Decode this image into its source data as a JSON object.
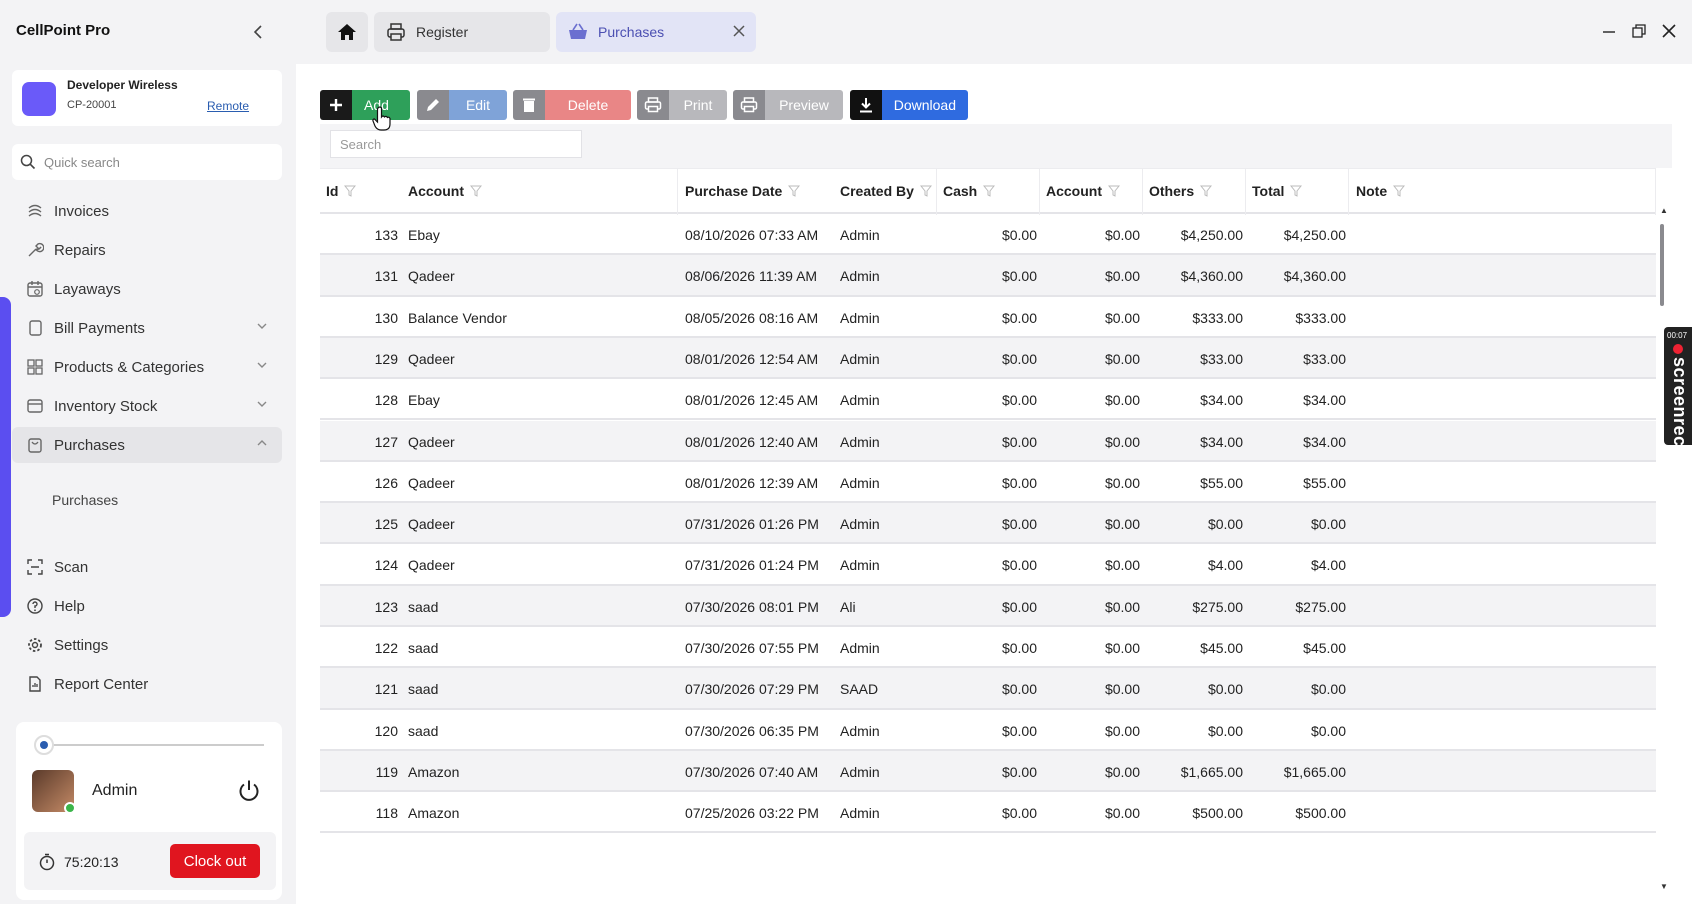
{
  "app": {
    "title": "CellPoint Pro"
  },
  "store": {
    "name": "Developer Wireless",
    "code": "CP-20001",
    "link": "Remote"
  },
  "search": {
    "placeholder": "Quick search"
  },
  "nav": {
    "items": [
      {
        "label": "Invoices",
        "icon": "invoice-icon"
      },
      {
        "label": "Repairs",
        "icon": "wrench-icon"
      },
      {
        "label": "Layaways",
        "icon": "calendar-icon"
      },
      {
        "label": "Bill Payments",
        "icon": "bill-icon",
        "expandable": true
      },
      {
        "label": "Products & Categories",
        "icon": "grid-icon",
        "expandable": true
      },
      {
        "label": "Inventory Stock",
        "icon": "box-icon",
        "expandable": true
      },
      {
        "label": "Purchases",
        "icon": "basket-icon",
        "expanded": true
      }
    ],
    "sub_items": [
      "Purchases"
    ],
    "bottom_items": [
      {
        "label": "Scan",
        "icon": "scan-icon"
      },
      {
        "label": "Help",
        "icon": "help-icon"
      },
      {
        "label": "Settings",
        "icon": "gear-icon"
      },
      {
        "label": "Report Center",
        "icon": "report-icon"
      }
    ]
  },
  "user": {
    "name": "Admin",
    "timer": "75:20:13",
    "clock_out": "Clock out",
    "status_color": "#3bb54a"
  },
  "tabs": [
    {
      "label": "Register",
      "icon": "printer-icon"
    },
    {
      "label": "Purchases",
      "icon": "basket-icon",
      "active": true
    }
  ],
  "toolbar": {
    "add": "Add",
    "edit": "Edit",
    "delete": "Delete",
    "print": "Print",
    "preview": "Preview",
    "download": "Download"
  },
  "grid": {
    "search_placeholder": "Search",
    "columns": [
      "Id",
      "Account",
      "Purchase Date",
      "Created By",
      "Cash",
      "Account",
      "Others",
      "Total",
      "Note"
    ],
    "rows": [
      {
        "id": "133",
        "account": "Ebay",
        "date": "08/10/2026 07:33 AM",
        "created_by": "Admin",
        "cash": "$0.00",
        "acct": "$0.00",
        "others": "$4,250.00",
        "total": "$4,250.00",
        "note": ""
      },
      {
        "id": "131",
        "account": "Qadeer",
        "date": "08/06/2026 11:39 AM",
        "created_by": "Admin",
        "cash": "$0.00",
        "acct": "$0.00",
        "others": "$4,360.00",
        "total": "$4,360.00",
        "note": ""
      },
      {
        "id": "130",
        "account": "Balance Vendor",
        "date": "08/05/2026 08:16 AM",
        "created_by": "Admin",
        "cash": "$0.00",
        "acct": "$0.00",
        "others": "$333.00",
        "total": "$333.00",
        "note": ""
      },
      {
        "id": "129",
        "account": "Qadeer",
        "date": "08/01/2026 12:54 AM",
        "created_by": "Admin",
        "cash": "$0.00",
        "acct": "$0.00",
        "others": "$33.00",
        "total": "$33.00",
        "note": ""
      },
      {
        "id": "128",
        "account": "Ebay",
        "date": "08/01/2026 12:45 AM",
        "created_by": "Admin",
        "cash": "$0.00",
        "acct": "$0.00",
        "others": "$34.00",
        "total": "$34.00",
        "note": ""
      },
      {
        "id": "127",
        "account": "Qadeer",
        "date": "08/01/2026 12:40 AM",
        "created_by": "Admin",
        "cash": "$0.00",
        "acct": "$0.00",
        "others": "$34.00",
        "total": "$34.00",
        "note": ""
      },
      {
        "id": "126",
        "account": "Qadeer",
        "date": "08/01/2026 12:39 AM",
        "created_by": "Admin",
        "cash": "$0.00",
        "acct": "$0.00",
        "others": "$55.00",
        "total": "$55.00",
        "note": ""
      },
      {
        "id": "125",
        "account": "Qadeer",
        "date": "07/31/2026 01:26 PM",
        "created_by": "Admin",
        "cash": "$0.00",
        "acct": "$0.00",
        "others": "$0.00",
        "total": "$0.00",
        "note": ""
      },
      {
        "id": "124",
        "account": "Qadeer",
        "date": "07/31/2026 01:24 PM",
        "created_by": "Admin",
        "cash": "$0.00",
        "acct": "$0.00",
        "others": "$4.00",
        "total": "$4.00",
        "note": ""
      },
      {
        "id": "123",
        "account": "saad",
        "date": "07/30/2026 08:01 PM",
        "created_by": "Ali",
        "cash": "$0.00",
        "acct": "$0.00",
        "others": "$275.00",
        "total": "$275.00",
        "note": ""
      },
      {
        "id": "122",
        "account": "saad",
        "date": "07/30/2026 07:55 PM",
        "created_by": "Admin",
        "cash": "$0.00",
        "acct": "$0.00",
        "others": "$45.00",
        "total": "$45.00",
        "note": ""
      },
      {
        "id": "121",
        "account": "saad",
        "date": "07/30/2026 07:29 PM",
        "created_by": "SAAD",
        "cash": "$0.00",
        "acct": "$0.00",
        "others": "$0.00",
        "total": "$0.00",
        "note": ""
      },
      {
        "id": "120",
        "account": "saad",
        "date": "07/30/2026 06:35 PM",
        "created_by": "Admin",
        "cash": "$0.00",
        "acct": "$0.00",
        "others": "$0.00",
        "total": "$0.00",
        "note": ""
      },
      {
        "id": "119",
        "account": "Amazon",
        "date": "07/30/2026 07:40 AM",
        "created_by": "Admin",
        "cash": "$0.00",
        "acct": "$0.00",
        "others": "$1,665.00",
        "total": "$1,665.00",
        "note": ""
      },
      {
        "id": "118",
        "account": "Amazon",
        "date": "07/25/2026 03:22 PM",
        "created_by": "Admin",
        "cash": "$0.00",
        "acct": "$0.00",
        "others": "$500.00",
        "total": "$500.00",
        "note": ""
      }
    ]
  },
  "recorder": {
    "time": "00:07",
    "label": "screenrec"
  },
  "colors": {
    "accent": "#5b4ef0",
    "add": "#2ea05a",
    "download": "#2f6be0",
    "clock_out": "#e0151f",
    "active_tab": "#e2e4f6"
  }
}
